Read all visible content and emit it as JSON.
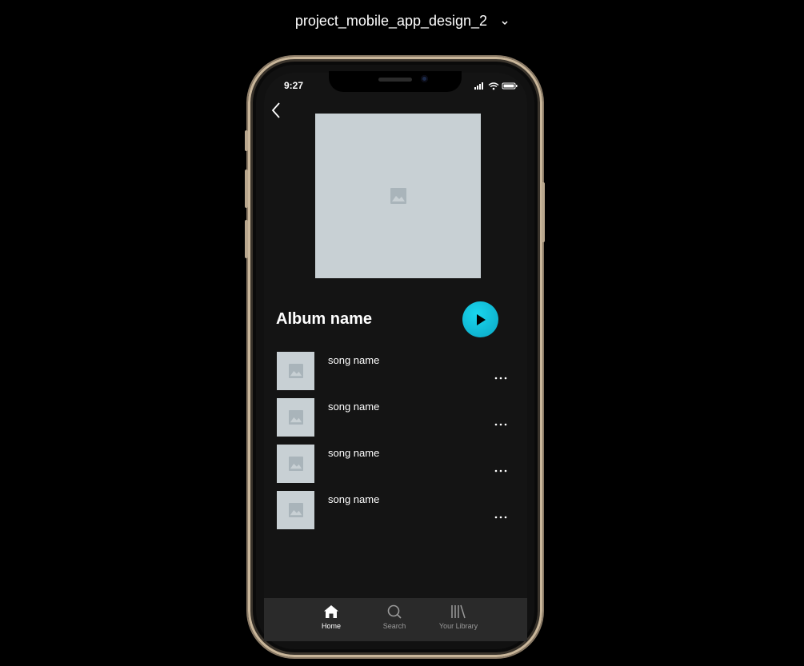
{
  "project": {
    "title": "project_mobile_app_design_2"
  },
  "status": {
    "time": "9:27"
  },
  "album": {
    "name": "Album name"
  },
  "songs": [
    {
      "name": "song name"
    },
    {
      "name": "song name"
    },
    {
      "name": "song name"
    },
    {
      "name": "song name"
    }
  ],
  "tabs": [
    {
      "label": "Home",
      "icon": "home-icon",
      "active": true
    },
    {
      "label": "Search",
      "icon": "search-icon",
      "active": false
    },
    {
      "label": "Your Library",
      "icon": "library-icon",
      "active": false
    }
  ],
  "colors": {
    "accent": "#0fbcd8",
    "background": "#141414",
    "tabbar": "#2a2a2a",
    "placeholder": "#c8d0d4"
  }
}
